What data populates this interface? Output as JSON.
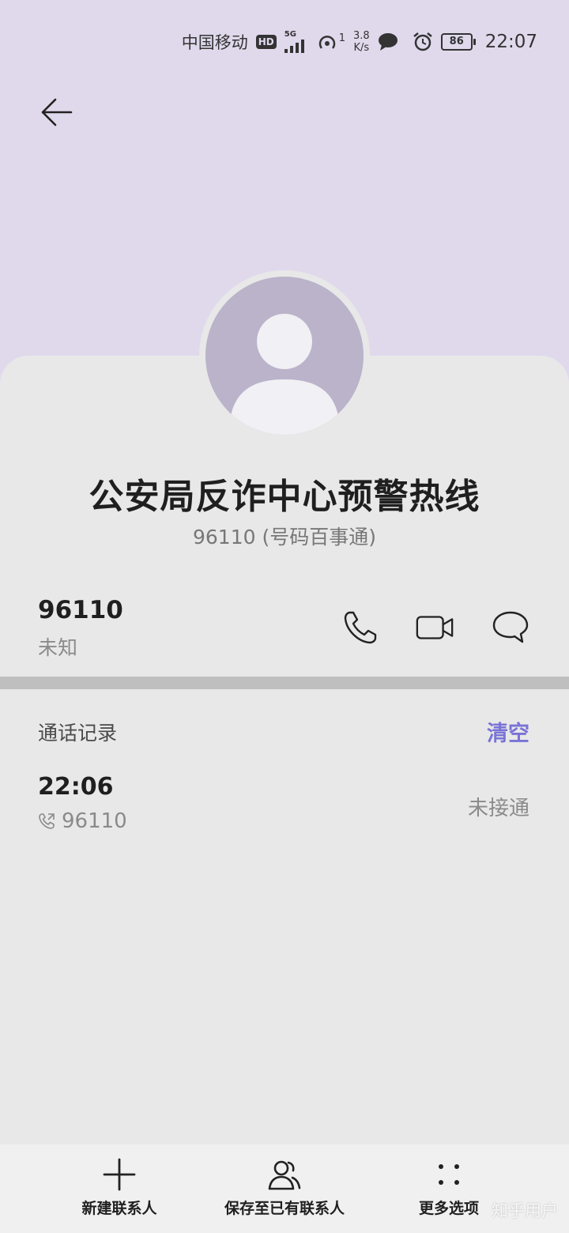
{
  "status_bar": {
    "carrier": "中国移动",
    "hd": "HD",
    "network": "5G",
    "hotspot_count": "1",
    "speed_value": "3.8",
    "speed_unit": "K/s",
    "battery": "86",
    "time": "22:07"
  },
  "header": {
    "back_icon": "arrow-left-icon"
  },
  "contact": {
    "name": "公安局反诈中心预警热线",
    "subtitle": "96110 (号码百事通)",
    "number": "96110",
    "number_type": "未知"
  },
  "actions": {
    "call_icon": "phone-icon",
    "video_icon": "video-call-icon",
    "message_icon": "message-icon"
  },
  "call_log": {
    "title": "通话记录",
    "clear_label": "清空",
    "entries": [
      {
        "time": "22:06",
        "number": "96110",
        "status": "未接通"
      }
    ]
  },
  "bottom_bar": {
    "items": [
      {
        "label": "新建联系人",
        "icon": "plus-icon"
      },
      {
        "label": "保存至已有联系人",
        "icon": "contacts-icon"
      },
      {
        "label": "更多选项",
        "icon": "more-dots-icon"
      }
    ]
  },
  "watermark": "知乎用户",
  "colors": {
    "header_bg": "#e0d9ec",
    "card_bg": "#e8e8e8",
    "accent": "#7a73d6",
    "avatar_bg": "#bab3ca"
  }
}
